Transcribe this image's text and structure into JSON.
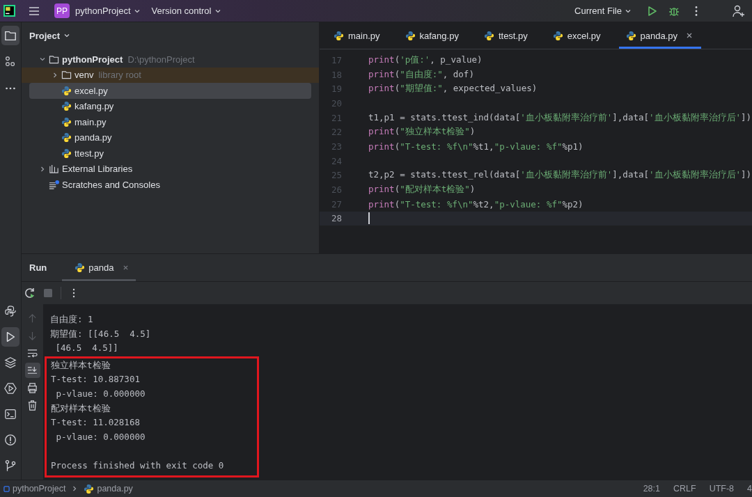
{
  "title_bar": {
    "project_badge": "PP",
    "project": "pythonProject",
    "vcs": "Version control",
    "run_config": "Current File"
  },
  "left_tools": [
    {
      "kind": "folder",
      "selected": true
    },
    {
      "kind": "structure",
      "selected": false
    },
    {
      "kind": "more",
      "selected": false
    }
  ],
  "bottom_tools": [
    {
      "kind": "python",
      "selected": false
    },
    {
      "kind": "run",
      "selected": true
    },
    {
      "kind": "layers",
      "selected": false
    },
    {
      "kind": "services",
      "selected": false
    },
    {
      "kind": "terminal",
      "selected": false
    },
    {
      "kind": "problems",
      "selected": false
    },
    {
      "kind": "git",
      "selected": false
    }
  ],
  "project_panel": {
    "title": "Project",
    "tree": [
      {
        "name": "pythonProject",
        "kind": "folder",
        "note": "D:\\pythonProject",
        "expanded": true,
        "selected": false,
        "highlighted": false,
        "children": [
          {
            "name": "venv",
            "kind": "folder",
            "note": "library root",
            "expanded": false,
            "selected": false,
            "highlighted": true
          },
          {
            "name": "excel.py",
            "kind": "file",
            "selected": true,
            "highlighted": false
          },
          {
            "name": "kafang.py",
            "kind": "file",
            "selected": false,
            "highlighted": false
          },
          {
            "name": "main.py",
            "kind": "file",
            "selected": false,
            "highlighted": false
          },
          {
            "name": "panda.py",
            "kind": "file",
            "selected": false,
            "highlighted": false
          },
          {
            "name": "ttest.py",
            "kind": "file",
            "selected": false,
            "highlighted": false
          }
        ]
      },
      {
        "name": "External Libraries",
        "kind": "libraries",
        "expanded": false,
        "selected": false,
        "highlighted": false
      },
      {
        "name": "Scratches and Consoles",
        "kind": "scratches",
        "selected": false,
        "highlighted": false
      }
    ]
  },
  "editor": {
    "tabs": [
      {
        "label": "main.py",
        "selected": false
      },
      {
        "label": "kafang.py",
        "selected": false
      },
      {
        "label": "ttest.py",
        "selected": false
      },
      {
        "label": "excel.py",
        "selected": false
      },
      {
        "label": "panda.py",
        "selected": true
      }
    ],
    "lines": [
      {
        "number": "17",
        "current": false,
        "tokens": [
          {
            "text": "print",
            "kind": "fn"
          },
          {
            "text": "(",
            "kind": "plain"
          },
          {
            "text": "'p值:'",
            "kind": "str"
          },
          {
            "text": ", p_value)",
            "kind": "plain"
          }
        ]
      },
      {
        "number": "18",
        "current": false,
        "tokens": [
          {
            "text": "print",
            "kind": "fn"
          },
          {
            "text": "(",
            "kind": "plain"
          },
          {
            "text": "\"自由度:\"",
            "kind": "str"
          },
          {
            "text": ", dof)",
            "kind": "plain"
          }
        ]
      },
      {
        "number": "19",
        "current": false,
        "tokens": [
          {
            "text": "print",
            "kind": "fn"
          },
          {
            "text": "(",
            "kind": "plain"
          },
          {
            "text": "\"期望值:\"",
            "kind": "str"
          },
          {
            "text": ", expected_values)",
            "kind": "plain"
          }
        ]
      },
      {
        "number": "20",
        "current": false
      },
      {
        "number": "21",
        "current": false,
        "tokens": [
          {
            "text": "t1,p1 = stats.ttest_ind(data[",
            "kind": "plain"
          },
          {
            "text": "'血小板黏附率治疗前'",
            "kind": "str"
          },
          {
            "text": "],data[",
            "kind": "plain"
          },
          {
            "text": "'血小板黏附率治疗后'",
            "kind": "str"
          },
          {
            "text": "])",
            "kind": "plain"
          }
        ]
      },
      {
        "number": "22",
        "current": false,
        "tokens": [
          {
            "text": "print",
            "kind": "fn"
          },
          {
            "text": "(",
            "kind": "plain"
          },
          {
            "text": "\"独立样本t检验\"",
            "kind": "str"
          },
          {
            "text": ")",
            "kind": "plain"
          }
        ]
      },
      {
        "number": "23",
        "current": false,
        "tokens": [
          {
            "text": "print",
            "kind": "fn"
          },
          {
            "text": "(",
            "kind": "plain"
          },
          {
            "text": "\"T-test: %f\\n\"",
            "kind": "str"
          },
          {
            "text": "%t1,",
            "kind": "plain"
          },
          {
            "text": "\"p-vlaue: %f\"",
            "kind": "str"
          },
          {
            "text": "%p1)",
            "kind": "plain"
          }
        ]
      },
      {
        "number": "24",
        "current": false
      },
      {
        "number": "25",
        "current": false,
        "tokens": [
          {
            "text": "t2,p2 = stats.ttest_rel(data[",
            "kind": "plain"
          },
          {
            "text": "'血小板黏附率治疗前'",
            "kind": "str"
          },
          {
            "text": "],data[",
            "kind": "plain"
          },
          {
            "text": "'血小板黏附率治疗后'",
            "kind": "str"
          },
          {
            "text": "])",
            "kind": "plain"
          }
        ]
      },
      {
        "number": "26",
        "current": false,
        "tokens": [
          {
            "text": "print",
            "kind": "fn"
          },
          {
            "text": "(",
            "kind": "plain"
          },
          {
            "text": "\"配对样本t检验\"",
            "kind": "str"
          },
          {
            "text": ")",
            "kind": "plain"
          }
        ]
      },
      {
        "number": "27",
        "current": false,
        "tokens": [
          {
            "text": "print",
            "kind": "fn"
          },
          {
            "text": "(",
            "kind": "plain"
          },
          {
            "text": "\"T-test: %f\\n\"",
            "kind": "str"
          },
          {
            "text": "%t2,",
            "kind": "plain"
          },
          {
            "text": "\"p-vlaue: %f\"",
            "kind": "str"
          },
          {
            "text": "%p2)",
            "kind": "plain"
          }
        ]
      },
      {
        "number": "28",
        "current": true
      }
    ]
  },
  "run_panel": {
    "title": "Run",
    "tab": "panda",
    "side_tools": [
      {
        "kind": "up",
        "selected": false
      },
      {
        "kind": "down",
        "selected": false
      },
      {
        "kind": "wrap",
        "selected": false
      },
      {
        "kind": "scroll-end",
        "selected": true
      },
      {
        "kind": "print",
        "selected": false
      },
      {
        "kind": "trash",
        "selected": false
      }
    ],
    "console": {
      "lines": [
        {
          "text": "自由度: 1",
          "kind": "output"
        },
        {
          "text": "期望值: [[46.5  4.5]",
          "kind": "output"
        },
        {
          "text": " [46.5  4.5]]",
          "kind": "output"
        }
      ],
      "highlighted_lines": [
        {
          "text": "独立样本t检验",
          "kind": "output"
        },
        {
          "text": "T-test: 10.887301",
          "kind": "output"
        },
        {
          "text": " p-vlaue: 0.000000",
          "kind": "output"
        },
        {
          "text": "配对样本t检验",
          "kind": "output"
        },
        {
          "text": "T-test: 11.028168",
          "kind": "output"
        },
        {
          "text": " p-vlaue: 0.000000",
          "kind": "output"
        },
        {
          "text": "Process finished with exit code 0",
          "kind": "exit"
        }
      ]
    }
  },
  "status_bar": {
    "breadcrumbs": [
      "pythonProject",
      "panda.py"
    ],
    "items": [
      "28:1",
      "CRLF",
      "UTF-8",
      "4"
    ]
  }
}
